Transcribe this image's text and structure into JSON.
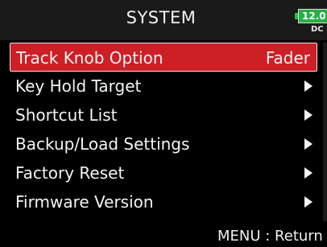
{
  "header": {
    "title": "SYSTEM",
    "battery_level": "12.0",
    "power_source": "DC",
    "battery_color": "#26b044"
  },
  "menu": {
    "items": [
      {
        "label": "Track Knob Option",
        "value": "Fader",
        "selected": true
      },
      {
        "label": "Key Hold Target",
        "icon": "chevron-right-icon",
        "selected": false
      },
      {
        "label": "Shortcut List",
        "icon": "chevron-right-icon",
        "selected": false
      },
      {
        "label": "Backup/Load Settings",
        "icon": "chevron-right-icon",
        "selected": false
      },
      {
        "label": "Factory Reset",
        "icon": "chevron-right-icon",
        "selected": false
      },
      {
        "label": "Firmware Version",
        "icon": "chevron-right-icon",
        "selected": false
      }
    ],
    "selected_color": "#cc1f26"
  },
  "footer": {
    "hint": "MENU : Return"
  }
}
